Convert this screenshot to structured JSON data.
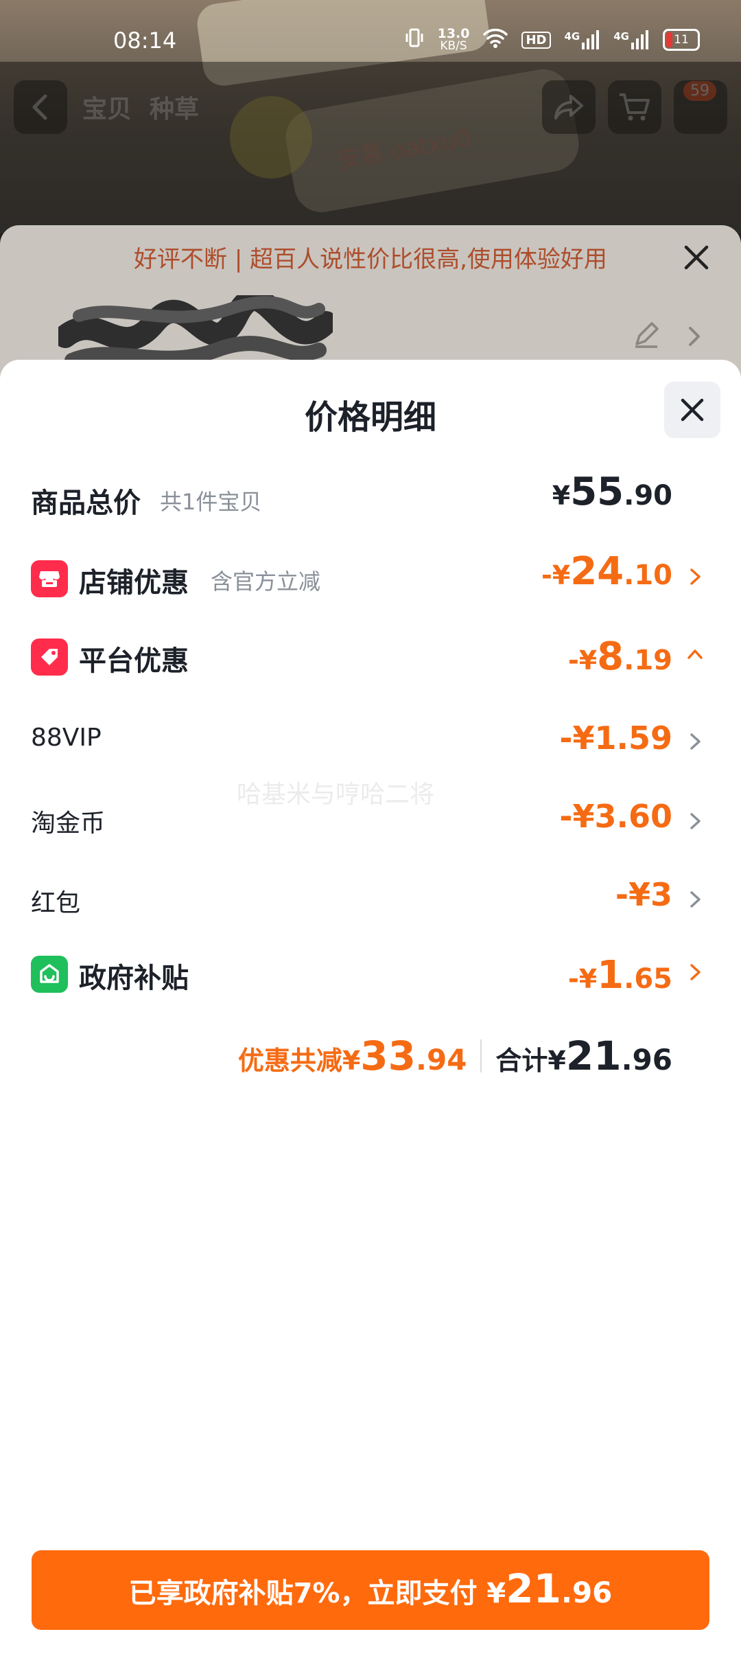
{
  "status_bar": {
    "time": "08:14",
    "net_speed_value": "13.0",
    "net_speed_unit": "KB/S",
    "hd_label": "HD",
    "signal1_label": "4G",
    "signal2_label": "4G",
    "battery": "11"
  },
  "nav": {
    "tabs": [
      "宝贝",
      "种草"
    ],
    "cart_badge": "59"
  },
  "background_sheet": {
    "banner": "好评不断 | 超百人说性价比很高,使用体验好用"
  },
  "sheet": {
    "title": "价格明细",
    "rows": {
      "goods_total": {
        "label": "商品总价",
        "sub": "共1件宝贝",
        "currency": "¥",
        "int": "55",
        "dec": ".90"
      },
      "shop_discount": {
        "label": "店铺优惠",
        "sub": "含官方立减",
        "prefix": "-¥",
        "int": "24",
        "dec": ".10"
      },
      "platform_discount": {
        "label": "平台优惠",
        "prefix": "-¥",
        "int": "8",
        "dec": ".19"
      },
      "vip": {
        "label": "88VIP",
        "amount": "-¥1.59"
      },
      "coin": {
        "label": "淘金币",
        "amount": "-¥3.60"
      },
      "redpacket": {
        "label": "红包",
        "amount": "-¥3"
      },
      "gov_subsidy": {
        "label": "政府补贴",
        "prefix": "-¥",
        "int": "1",
        "dec": ".65"
      }
    },
    "summary": {
      "discount_label": "优惠共减¥",
      "discount_int": "33",
      "discount_dec": ".94",
      "total_label": "合计¥",
      "total_int": "21",
      "total_dec": ".96"
    },
    "watermark": "哈基米与哼哈二将"
  },
  "pay_button": {
    "text": "已享政府补贴7%，立即支付 ¥",
    "int": "21",
    "dec": ".96"
  },
  "colors": {
    "accent": "#ff6a0d",
    "discount_text": "#f56b14",
    "shop_icon": "#ff2c4b",
    "platform_icon": "#ff2c4b",
    "gov_icon": "#1fbf5b"
  }
}
